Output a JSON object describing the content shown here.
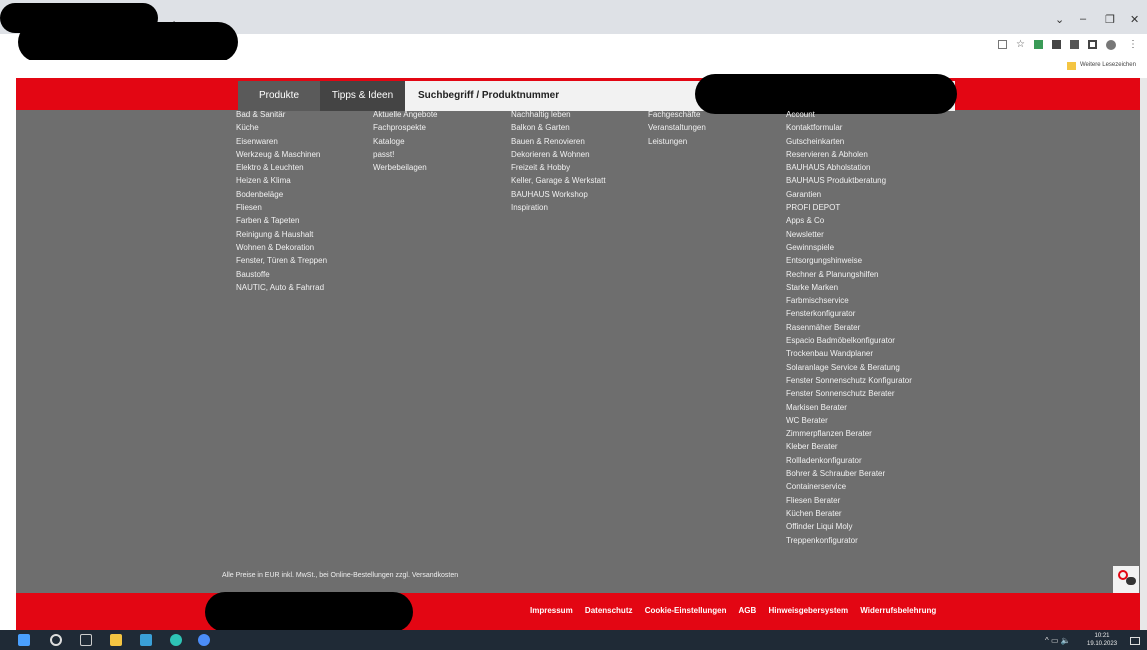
{
  "browser": {
    "new_tab": "+",
    "controls": {
      "chevron": "⌄",
      "minimize": "–",
      "restore": "❐",
      "close": "✕"
    },
    "toolbar_icons": [
      "share-icon",
      "star-icon",
      "extension-icon",
      "puzzle-icon",
      "user-icon",
      "sidebar-icon",
      "profile-icon",
      "menu-icon"
    ],
    "bookmarks_folder": "Weitere Lesezeichen"
  },
  "nav": {
    "produkte": "Produkte",
    "tipps": "Tipps & Ideen",
    "search_placeholder": "Suchbegriff / Produktnummer"
  },
  "columns": {
    "col1": [
      "Bad & Sanitär",
      "Küche",
      "Eisenwaren",
      "Werkzeug & Maschinen",
      "Elektro & Leuchten",
      "Heizen & Klima",
      "Bodenbeläge",
      "Fliesen",
      "Farben & Tapeten",
      "Reinigung & Haushalt",
      "Wohnen & Dekoration",
      "Fenster, Türen & Treppen",
      "Baustoffe",
      "NAUTIC, Auto & Fahrrad"
    ],
    "col2": [
      "Aktuelle Angebote",
      "Fachprospekte",
      "Kataloge",
      "passt!",
      "Werbebeilagen"
    ],
    "col3": [
      "Nachhaltig leben",
      "Balkon & Garten",
      "Bauen & Renovieren",
      "Dekorieren & Wohnen",
      "Freizeit & Hobby",
      "Keller, Garage & Werkstatt",
      "BAUHAUS Workshop",
      "Inspiration"
    ],
    "col4": [
      "Fachgeschäfte",
      "Veranstaltungen",
      "Leistungen"
    ],
    "col5": [
      "Account",
      "Kontaktformular",
      "Gutscheinkarten",
      "Reservieren & Abholen",
      "BAUHAUS Abholstation",
      "BAUHAUS Produktberatung",
      "Garantien",
      "PROFI DEPOT",
      "Apps & Co",
      "Newsletter",
      "Gewinnspiele",
      "Entsorgungshinweise",
      "Rechner & Planungshilfen",
      "Starke Marken",
      "Farbmischservice",
      "Fensterkonfigurator",
      "Rasenmäher Berater",
      "Espacio Badmöbelkonfigurator",
      "Trockenbau Wandplaner",
      "Solaranlage Service & Beratung",
      "Fenster Sonnenschutz Konfigurator",
      "Fenster Sonnenschutz Berater",
      "Markisen Berater",
      "WC Berater",
      "Zimmerpflanzen Berater",
      "Kleber Berater",
      "Rollladenkonfigurator",
      "Bohrer & Schrauber Berater",
      "Containerservice",
      "Fliesen Berater",
      "Küchen Berater",
      "Offinder Liqui Moly",
      "Treppenkonfigurator"
    ]
  },
  "price_note": "Alle Preise in EUR inkl. MwSt., bei Online-Bestellungen zzgl. Versandkosten",
  "footer_links": [
    "Impressum",
    "Datenschutz",
    "Cookie-Einstellungen",
    "AGB",
    "Hinweisgebersystem",
    "Widerrufsbelehrung"
  ],
  "taskbar": {
    "time": "10:21",
    "date": "19.10.2023"
  }
}
